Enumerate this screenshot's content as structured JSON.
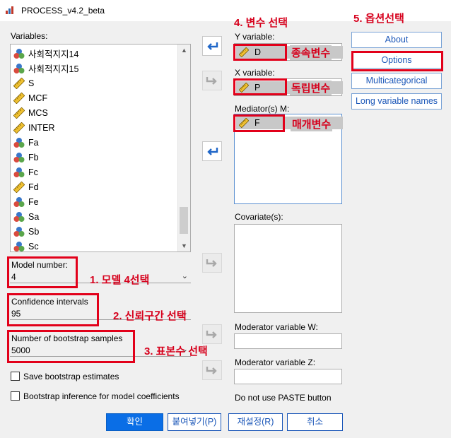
{
  "window": {
    "title": "PROCESS_v4.2_beta"
  },
  "variables": {
    "label": "Variables:",
    "items": [
      {
        "name": "사회적지지14",
        "icon": "nominal-icon"
      },
      {
        "name": "사회적지지15",
        "icon": "nominal-icon"
      },
      {
        "name": "S",
        "icon": "scale-icon"
      },
      {
        "name": "MCF",
        "icon": "scale-icon"
      },
      {
        "name": "MCS",
        "icon": "scale-icon"
      },
      {
        "name": "INTER",
        "icon": "scale-icon"
      },
      {
        "name": "Fa",
        "icon": "nominal-icon"
      },
      {
        "name": "Fb",
        "icon": "nominal-icon"
      },
      {
        "name": "Fc",
        "icon": "nominal-icon"
      },
      {
        "name": "Fd",
        "icon": "scale-icon"
      },
      {
        "name": "Fe",
        "icon": "nominal-icon"
      },
      {
        "name": "Sa",
        "icon": "nominal-icon"
      },
      {
        "name": "Sb",
        "icon": "nominal-icon"
      },
      {
        "name": "Sc",
        "icon": "nominal-icon"
      }
    ]
  },
  "model_number": {
    "label": "Model number:",
    "value": "4"
  },
  "confidence": {
    "label": "Confidence intervals",
    "value": "95"
  },
  "bootstrap": {
    "label": "Number of bootstrap samples",
    "value": "5000"
  },
  "checkboxes": {
    "save_bootstrap": {
      "label": "Save bootstrap estimates",
      "checked": false
    },
    "bootstrap_inference": {
      "label": "Bootstrap inference for model coefficients",
      "checked": false
    }
  },
  "y_variable": {
    "label": "Y variable:",
    "value": "D"
  },
  "x_variable": {
    "label": "X variable:",
    "value": "P"
  },
  "mediators": {
    "label": "Mediator(s) M:",
    "items": [
      "F"
    ]
  },
  "covariates": {
    "label": "Covariate(s):"
  },
  "moderator_w": {
    "label": "Moderator variable W:",
    "value": ""
  },
  "moderator_z": {
    "label": "Moderator variable Z:",
    "value": ""
  },
  "paste_note": "Do not use PASTE button",
  "side_buttons": {
    "about": "About",
    "options": "Options",
    "multicategorical": "Multicategorical",
    "long_names": "Long variable names"
  },
  "bottom_buttons": {
    "ok": "확인",
    "paste": "붙여넣기(P)",
    "reset": "재설정(R)",
    "cancel": "취소"
  },
  "annotations": {
    "a1": "1. 모델 4선택",
    "a2": "2. 신뢰구간 선택",
    "a3": "3. 표본수 선택",
    "a4": "4. 변수 선택",
    "a5": "5. 옵션선택",
    "dep": "종속변수",
    "indep": "독립변수",
    "med": "매개변수"
  },
  "colors": {
    "annotation_red": "#e2001a",
    "ok_blue": "#0a6ee6",
    "link_blue": "#1a56b8"
  }
}
